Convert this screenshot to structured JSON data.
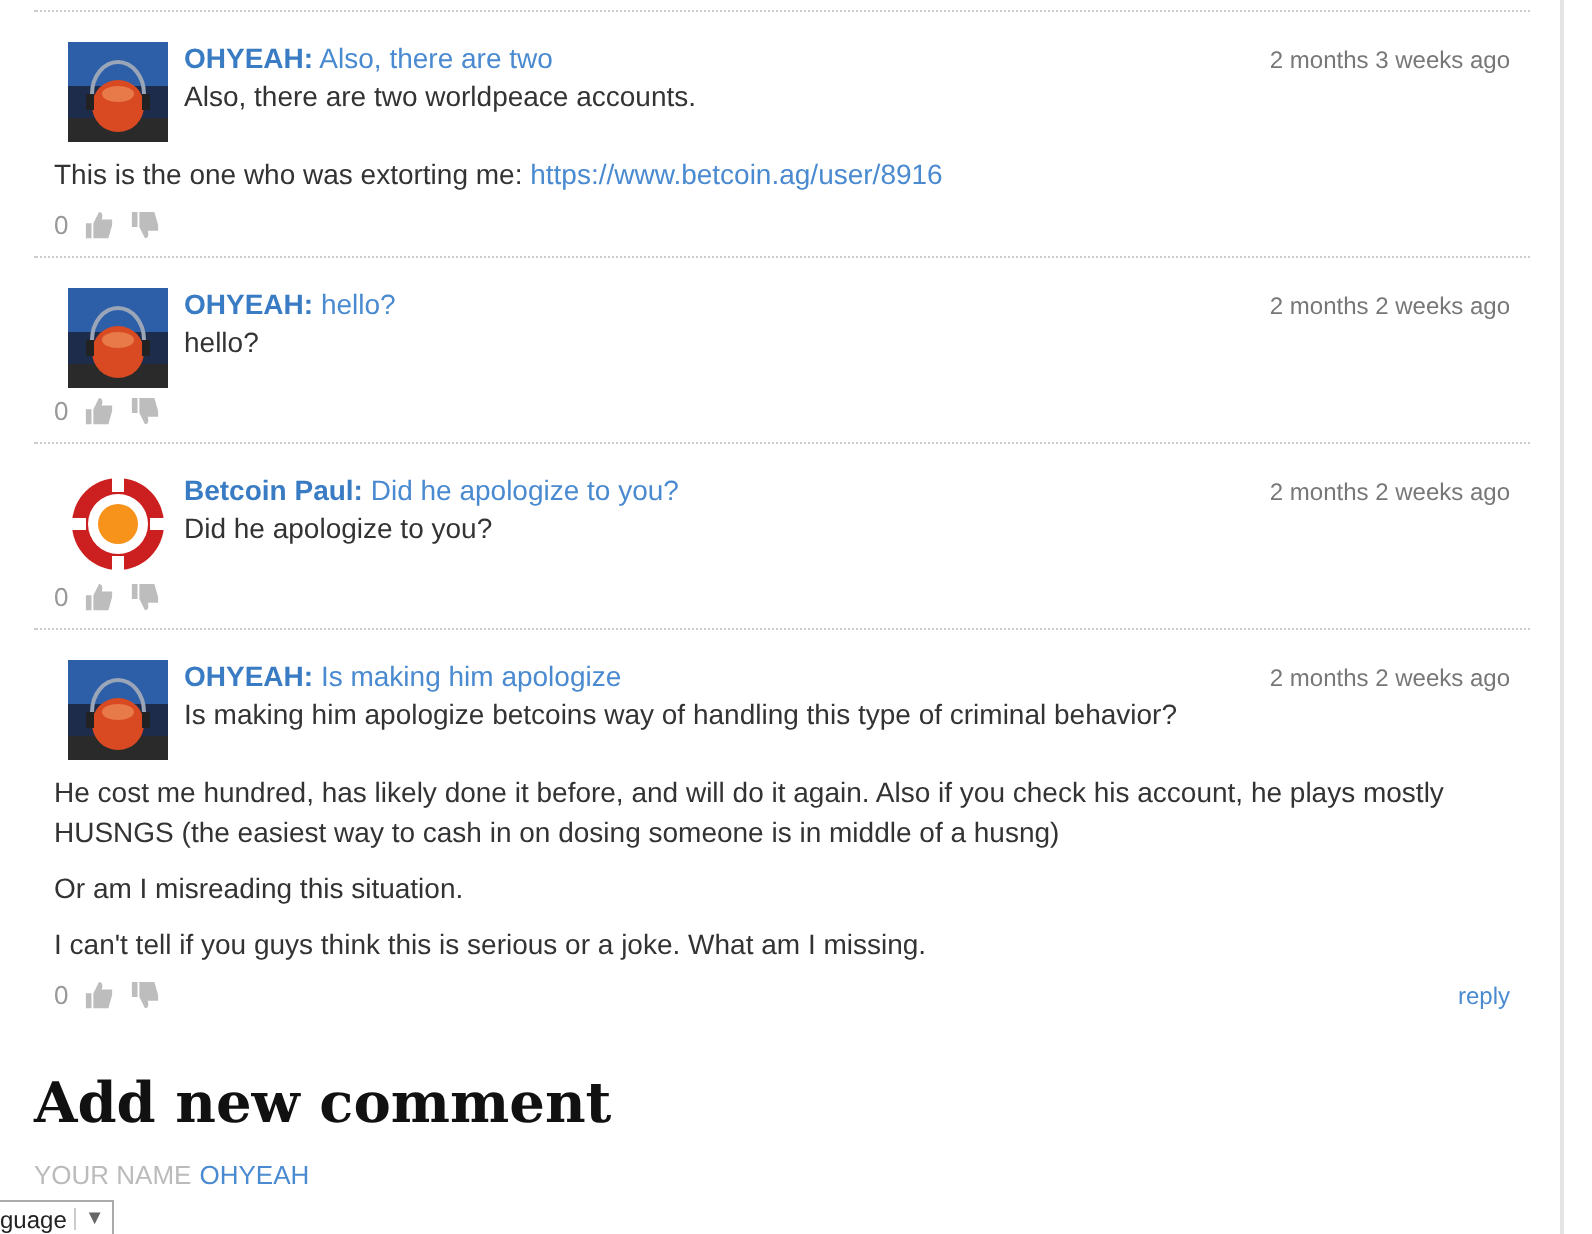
{
  "comments": [
    {
      "author": "OHYEAH:",
      "title": "Also, there are two",
      "date": "2 months 3 weeks ago",
      "avatar": {
        "kind": "picture"
      },
      "lead": "Also, there are two worldpeace accounts.",
      "paragraphs": [
        {
          "text": "This is the one who was extorting me: ",
          "link": "https://www.betcoin.ag/user/8916"
        }
      ],
      "votes": "0"
    },
    {
      "author": "OHYEAH:",
      "title": "hello?",
      "date": "2 months 2 weeks ago",
      "avatar": {
        "kind": "picture"
      },
      "lead": "hello?",
      "votes": "0"
    },
    {
      "author": "Betcoin Paul:",
      "title": "Did he apologize to you?",
      "date": "2 months 2 weeks ago",
      "avatar": {
        "kind": "icon"
      },
      "lead": "Did he apologize to you?",
      "votes": "0"
    },
    {
      "author": "OHYEAH:",
      "title": "Is making him apologize",
      "date": "2 months 2 weeks ago",
      "avatar": {
        "kind": "picture"
      },
      "lead": "Is making him apologize betcoins way of handling this type of criminal behavior?",
      "paragraphs": [
        {
          "text": "He cost me hundred, has likely done it before, and will do it again. Also if you check his account, he plays mostly HUSNGS (the easiest way to cash in on dosing someone is in middle of a husng)"
        },
        {
          "text": "Or am I misreading this situation."
        },
        {
          "text": "I can't tell if you guys think this is serious or a joke. What am I missing."
        }
      ],
      "votes": "0",
      "reply": "reply"
    }
  ],
  "add_comment": {
    "heading": "Add new comment",
    "name_label": "YOUR NAME",
    "name_value": "OHYEAH"
  },
  "language_widget": {
    "label": "guage",
    "caret": "▼"
  }
}
